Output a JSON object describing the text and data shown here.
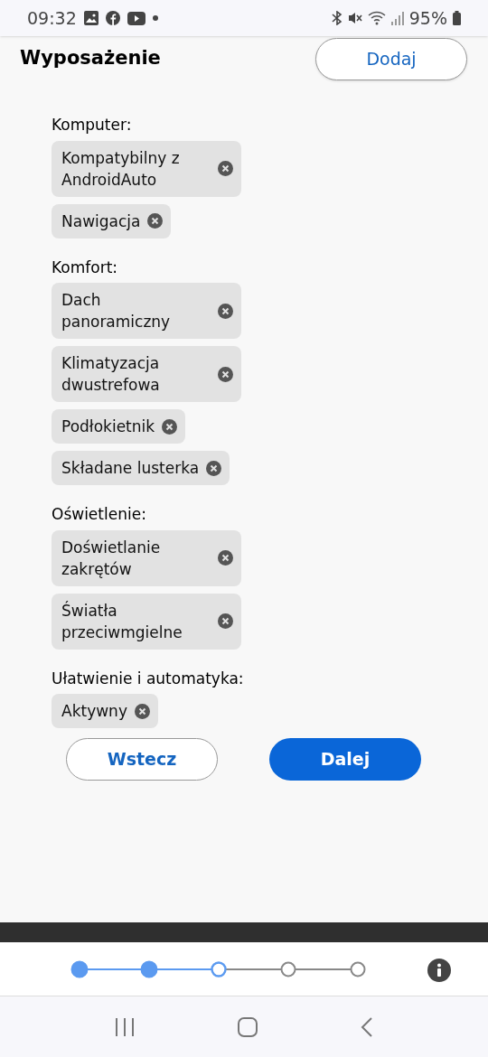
{
  "status_bar": {
    "time": "09:32",
    "battery": "95%"
  },
  "header": {
    "title": "Wyposażenie",
    "add_button": "Dodaj"
  },
  "sections": [
    {
      "title": "Komputer:",
      "chips": [
        "Kompatybilny z AndroidAuto",
        "Nawigacja"
      ]
    },
    {
      "title": "Komfort:",
      "chips": [
        "Dach panoramiczny",
        "Klimatyzacja dwustrefowa",
        "Podłokietnik",
        "Składane lusterka"
      ]
    },
    {
      "title": "Oświetlenie:",
      "chips": [
        "Doświetlanie zakrętów",
        "Światła przeciwmgielne"
      ]
    },
    {
      "title": "Ułatwienie i automatyka:",
      "chips": [
        "Aktywny"
      ]
    }
  ],
  "buttons": {
    "back": "Wstecz",
    "next": "Dalej"
  },
  "stepper": [
    {
      "completed": true,
      "selected": false
    },
    {
      "completed": true,
      "selected": false
    },
    {
      "completed": false,
      "selected": true
    },
    {
      "completed": false,
      "selected": false
    },
    {
      "completed": false,
      "selected": false
    }
  ]
}
